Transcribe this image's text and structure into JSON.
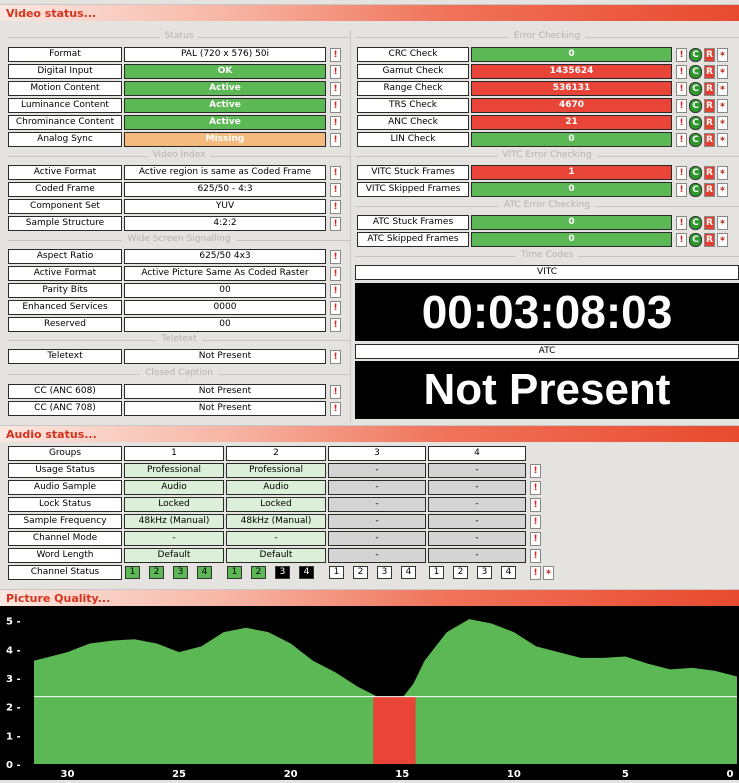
{
  "video_header": "Video status...",
  "audio_header": "Audio status...",
  "pq_header": "Picture Quality...",
  "groups": {
    "status": "Status",
    "video_index": "Video Index",
    "wss": "Wide Screen Signalling",
    "teletext": "Teletext",
    "cc": "Closed Caption",
    "error": "Error Checking",
    "vitc_err": "VITC Error Checking",
    "atc_err": "ATC Error Checking",
    "timecodes": "Time Codes"
  },
  "status_rows": [
    {
      "label": "Format",
      "value": "PAL (720 x 576) 50i",
      "style": "w"
    },
    {
      "label": "Digital Input",
      "value": "OK",
      "style": "g"
    },
    {
      "label": "Motion Content",
      "value": "Active",
      "style": "g"
    },
    {
      "label": "Luminance Content",
      "value": "Active",
      "style": "g"
    },
    {
      "label": "Chrominance Content",
      "value": "Active",
      "style": "g"
    },
    {
      "label": "Analog Sync",
      "value": "Missing",
      "style": "o"
    }
  ],
  "video_index_rows": [
    {
      "label": "Active Format",
      "value": "Active region is same as Coded Frame"
    },
    {
      "label": "Coded Frame",
      "value": "625/50 - 4:3"
    },
    {
      "label": "Component Set",
      "value": "YUV"
    },
    {
      "label": "Sample Structure",
      "value": "4:2:2"
    }
  ],
  "wss_rows": [
    {
      "label": "Aspect Ratio",
      "value": "625/50 4x3"
    },
    {
      "label": "Active Format",
      "value": "Active Picture Same As Coded Raster"
    },
    {
      "label": "Parity Bits",
      "value": "00"
    },
    {
      "label": "Enhanced Services",
      "value": "0000"
    },
    {
      "label": "Reserved",
      "value": "00"
    }
  ],
  "teletext_rows": [
    {
      "label": "Teletext",
      "value": "Not Present"
    }
  ],
  "cc_rows": [
    {
      "label": "CC (ANC 608)",
      "value": "Not Present"
    },
    {
      "label": "CC (ANC 708)",
      "value": "Not Present"
    }
  ],
  "error_rows": [
    {
      "label": "CRC Check",
      "value": "0",
      "style": "g"
    },
    {
      "label": "Gamut Check",
      "value": "1435624",
      "style": "r"
    },
    {
      "label": "Range Check",
      "value": "536131",
      "style": "r"
    },
    {
      "label": "TRS Check",
      "value": "4670",
      "style": "r"
    },
    {
      "label": "ANC Check",
      "value": "21",
      "style": "r"
    },
    {
      "label": "LIN Check",
      "value": "0",
      "style": "g"
    }
  ],
  "vitc_rows": [
    {
      "label": "VITC Stuck Frames",
      "value": "1",
      "style": "r"
    },
    {
      "label": "VITC Skipped Frames",
      "value": "0",
      "style": "g"
    }
  ],
  "atc_rows": [
    {
      "label": "ATC Stuck Frames",
      "value": "0",
      "style": "g"
    },
    {
      "label": "ATC Skipped Frames",
      "value": "0",
      "style": "g"
    }
  ],
  "timecodes": {
    "vitc_label": "VITC",
    "vitc_value": "00:03:08:03",
    "atc_label": "ATC",
    "atc_value": "Not Present"
  },
  "icons": {
    "exclaim": "!",
    "reset": "R",
    "cycle": "C"
  },
  "audio": {
    "columns": [
      "Groups",
      "1",
      "2",
      "3",
      "4"
    ],
    "rows": [
      {
        "label": "Usage Status",
        "cells": [
          "Professional",
          "Professional",
          "-",
          "-"
        ]
      },
      {
        "label": "Audio Sample",
        "cells": [
          "Audio",
          "Audio",
          "-",
          "-"
        ]
      },
      {
        "label": "Lock Status",
        "cells": [
          "Locked",
          "Locked",
          "-",
          "-"
        ]
      },
      {
        "label": "Sample Frequency",
        "cells": [
          "48kHz (Manual)",
          "48kHz (Manual)",
          "-",
          "-"
        ]
      },
      {
        "label": "Channel Mode",
        "cells": [
          "-",
          "-",
          "-",
          "-"
        ]
      },
      {
        "label": "Word Length",
        "cells": [
          "Default",
          "Default",
          "-",
          "-"
        ]
      }
    ],
    "channel_status_label": "Channel Status",
    "channel_status": [
      [
        "g",
        "g",
        "g",
        "g"
      ],
      [
        "g",
        "g",
        "k",
        "k"
      ],
      [
        "w",
        "w",
        "w",
        "w"
      ],
      [
        "w",
        "w",
        "w",
        "w"
      ]
    ],
    "channel_numbers": [
      "1",
      "2",
      "3",
      "4"
    ]
  },
  "chart_data": {
    "type": "area",
    "y_ticks": [
      "0",
      "1",
      "2",
      "3",
      "4",
      "5"
    ],
    "x_ticks": [
      "30",
      "25",
      "20",
      "15",
      "10",
      "5",
      "0"
    ],
    "ylim": [
      0,
      5.3
    ],
    "xlim": [
      31.5,
      0
    ],
    "threshold": 2.35,
    "colors": {
      "above": "#5cb854",
      "below": "#e84438",
      "line": "#ffffff"
    },
    "series": {
      "x": [
        31.5,
        30,
        29,
        28,
        27,
        26,
        25,
        24,
        23,
        22,
        21,
        20,
        19,
        18,
        17,
        16,
        15.5,
        15,
        14.5,
        14,
        13,
        12,
        11,
        10,
        9,
        8,
        7,
        6,
        5,
        4,
        3,
        2,
        1,
        0
      ],
      "y": [
        3.6,
        3.9,
        4.2,
        4.3,
        4.35,
        4.2,
        3.9,
        4.1,
        4.6,
        4.75,
        4.6,
        4.2,
        3.6,
        3.2,
        2.7,
        2.3,
        2.2,
        2.3,
        2.8,
        3.6,
        4.6,
        5.05,
        4.9,
        4.6,
        4.1,
        3.9,
        3.7,
        3.7,
        3.75,
        3.5,
        3.3,
        3.35,
        3.25,
        3.05
      ]
    }
  }
}
